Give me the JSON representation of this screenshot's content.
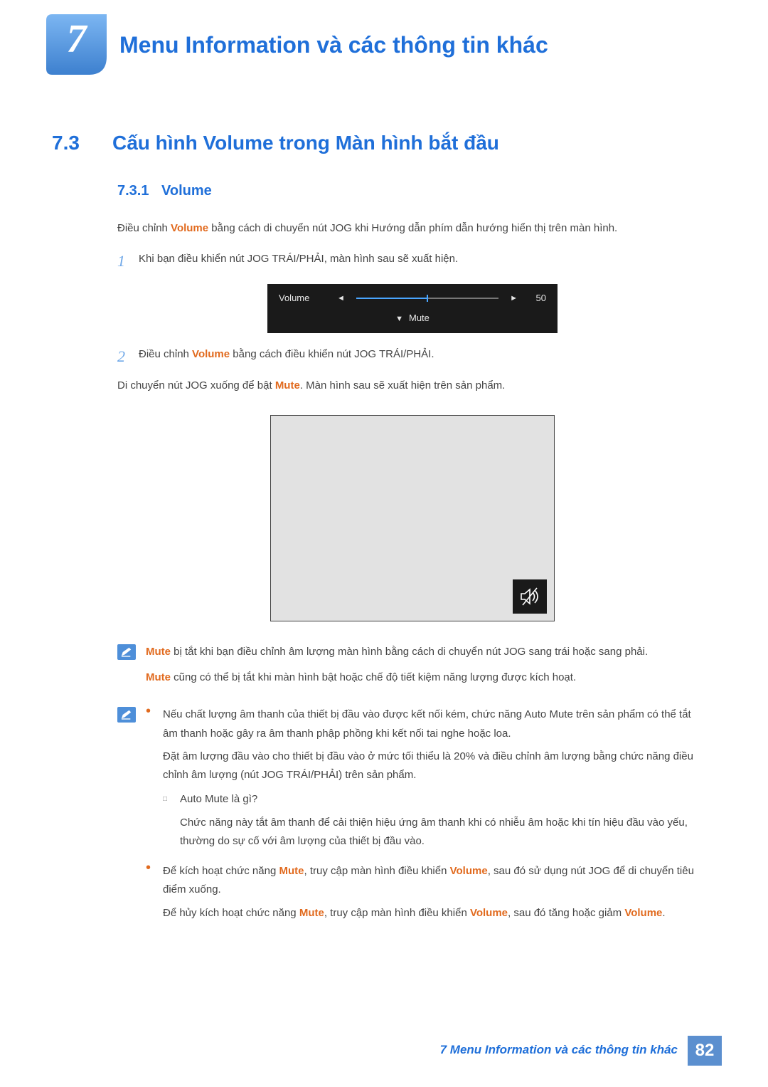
{
  "chapter": {
    "number": "7",
    "title": "Menu Information và các thông tin khác"
  },
  "section": {
    "number": "7.3",
    "title": "Cấu hình Volume trong Màn hình bắt đầu"
  },
  "subsection": {
    "number": "7.3.1",
    "title": "Volume"
  },
  "intro": {
    "pre": "Điều chỉnh ",
    "kw": "Volume",
    "post": " bằng cách di chuyển nút JOG khi Hướng dẫn phím dẫn hướng hiển thị trên màn hình."
  },
  "steps": {
    "s1": {
      "num": "1",
      "text": "Khi bạn điều khiển nút JOG TRÁI/PHẢI, màn hình sau sẽ xuất hiện."
    },
    "s2": {
      "num": "2",
      "pre": "Điều chỉnh ",
      "kw": "Volume",
      "post": " bằng cách điều khiển nút JOG TRÁI/PHẢI."
    }
  },
  "osd": {
    "label": "Volume",
    "value": "50",
    "value_pct": 50,
    "mute_label": "Mute"
  },
  "after_step2": {
    "pre": "Di chuyển nút JOG xuống để bật ",
    "kw": "Mute",
    "post": ". Màn hình sau sẽ xuất hiện trên sản phẩm."
  },
  "note1": {
    "p1": {
      "kw": "Mute",
      "post": " bị tắt khi bạn điều chỉnh âm lượng màn hình bằng cách di chuyển nút JOG sang trái hoặc sang phải."
    },
    "p2": {
      "kw": "Mute",
      "post": " cũng có thể bị tắt khi màn hình bật hoặc chế độ tiết kiệm năng lượng được kích hoạt."
    }
  },
  "note2": {
    "b1a": "Nếu chất lượng âm thanh của thiết bị đầu vào được kết nối kém, chức năng Auto Mute trên sản phẩm có thể tắt âm thanh hoặc gây ra âm thanh phập phồng khi kết nối tai nghe hoặc loa.",
    "b1b": "Đặt âm lượng đầu vào cho thiết bị đầu vào ở mức tối thiểu là 20% và điều chỉnh âm lượng bằng chức năng điều chỉnh âm lượng (nút JOG TRÁI/PHẢI) trên sản phẩm.",
    "sub_q": "Auto Mute là gì?",
    "sub_a": "Chức năng này tắt âm thanh để cải thiện hiệu ứng âm thanh khi có nhiễu âm hoặc khi tín hiệu đầu vào yếu, thường do sự cố với âm lượng của thiết bị đầu vào.",
    "b2": {
      "pre": "Để kích hoạt chức năng ",
      "k1": "Mute",
      "mid": ", truy cập màn hình điều khiển ",
      "k2": "Volume",
      "post": ", sau đó sử dụng nút JOG để di chuyển tiêu điểm xuống."
    },
    "b2b": {
      "pre": "Để hủy kích hoạt chức năng ",
      "k1": "Mute",
      "mid": ", truy cập màn hình điều khiển ",
      "k2": "Volume",
      "post1": ", sau đó tăng hoặc giảm ",
      "k3": "Volume",
      "post2": "."
    }
  },
  "footer": {
    "text": "7 Menu Information và các thông tin khác",
    "page": "82"
  }
}
